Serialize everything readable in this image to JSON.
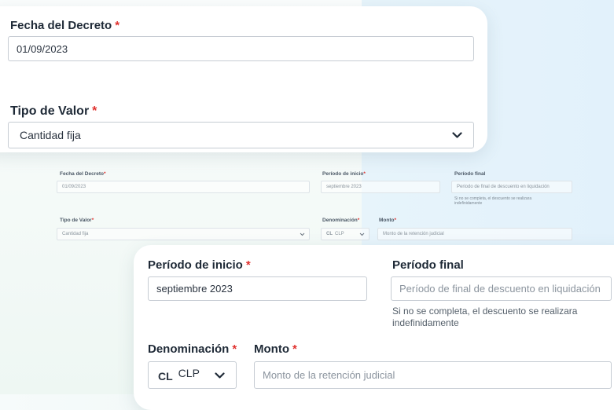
{
  "card_top": {
    "fecha": {
      "label": "Fecha del Decreto",
      "required": "*",
      "value": "01/09/2023"
    },
    "tipo": {
      "label": "Tipo de Valor",
      "required": "*",
      "value": "Cantidad fija"
    }
  },
  "mini_form": {
    "fecha_label": "Fecha del Decreto",
    "fecha_req": "*",
    "fecha_value": "01/09/2023",
    "inicio_label": "Período de inicio",
    "inicio_req": "*",
    "inicio_value": "septiembre 2023",
    "final_label": "Período final",
    "final_placeholder": "Periodo de final de descuento en liquidación",
    "final_hint": "Si no se completa, el descuento se realizara indefinidamente",
    "tipo_label": "Tipo de Valor",
    "tipo_req": "*",
    "tipo_value": "Cantidad fija",
    "denom_label": "Denominación",
    "denom_req": "*",
    "monto_label": "Monto",
    "monto_req": "*",
    "denom_prefix": "CL",
    "denom_value": "CLP",
    "monto_placeholder": "Monto de la retención judicial"
  },
  "card_bottom": {
    "inicio": {
      "label": "Período de inicio",
      "required": "*",
      "value": "septiembre 2023"
    },
    "final": {
      "label": "Período final",
      "placeholder": "Período de final de descuento en liquidación",
      "hint": "Si no se completa, el descuento se realizara indefinidamente"
    },
    "denominacion": {
      "label": "Denominación",
      "required": "*",
      "prefix": "CL",
      "value": "CLP"
    },
    "monto": {
      "label": "Monto",
      "required": "*",
      "placeholder": "Monto de la retención judicial"
    }
  }
}
